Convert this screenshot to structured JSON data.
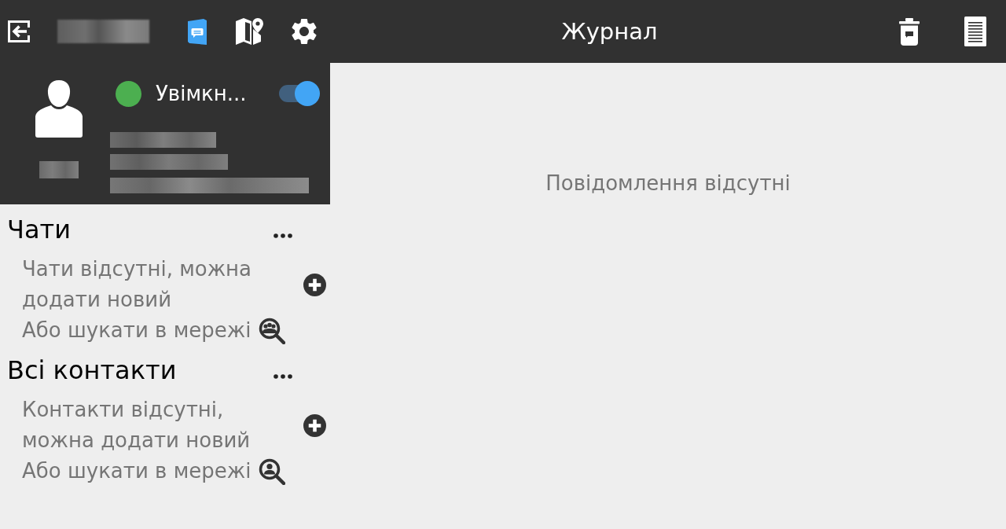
{
  "toolbar": {
    "nav": [
      {
        "kind": "journal",
        "selected": true
      },
      {
        "kind": "map",
        "selected": false
      },
      {
        "kind": "settings",
        "selected": false
      }
    ],
    "title": "Журнал"
  },
  "profile": {
    "status": {
      "label": "Увімкн...",
      "online": true
    },
    "toggle": {
      "on": true
    }
  },
  "sections": [
    {
      "kind": "chats",
      "title": "Чати",
      "empty_text": "Чати відсутні, можна додати новий",
      "search_text": "Або шукати в мережі"
    },
    {
      "kind": "contacts",
      "title": "Всі контакти",
      "empty_text": "Контакти відсутні, можна додати новий",
      "search_text": "Або шукати в мережі"
    }
  ],
  "content": {
    "empty_text": "Повідомлення відсутні"
  }
}
